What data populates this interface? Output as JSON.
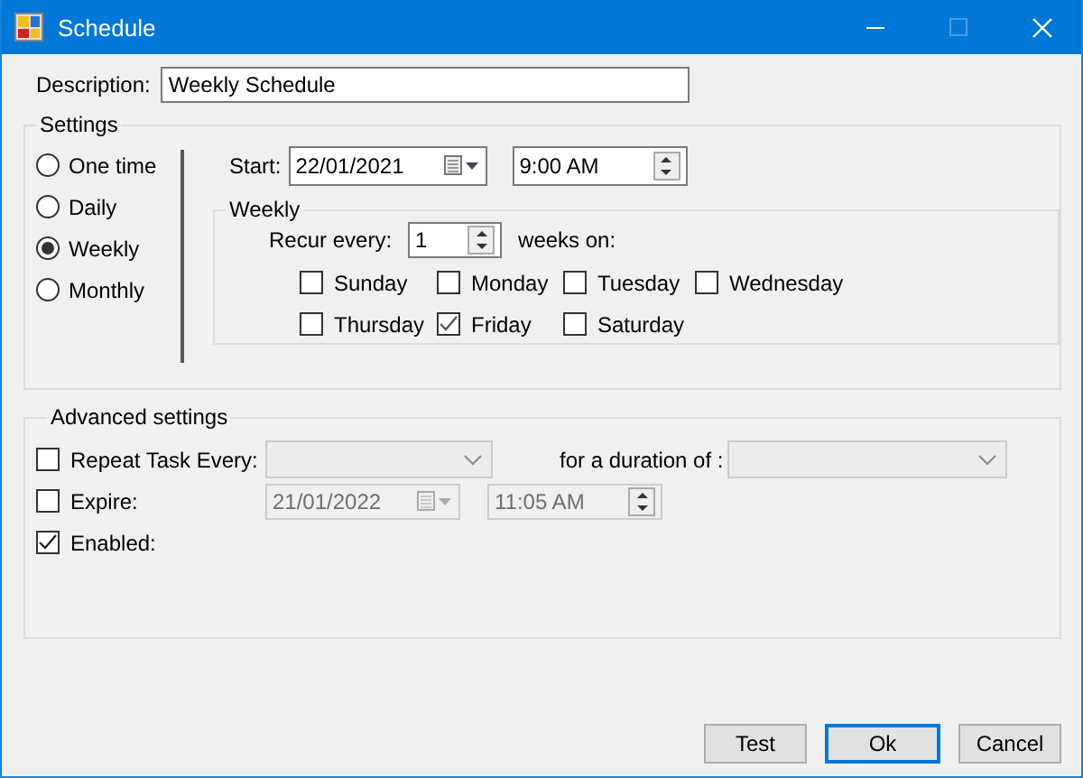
{
  "window": {
    "title": "Schedule"
  },
  "description": {
    "label": "Description:",
    "value": "Weekly Schedule"
  },
  "settings": {
    "title": "Settings",
    "frequency": [
      {
        "label": "One time",
        "selected": false
      },
      {
        "label": "Daily",
        "selected": false
      },
      {
        "label": "Weekly",
        "selected": true
      },
      {
        "label": "Monthly",
        "selected": false
      }
    ],
    "start": {
      "label": "Start:",
      "date": "22/01/2021",
      "time": "9:00 AM"
    },
    "weekly": {
      "title": "Weekly",
      "recur_label": "Recur every:",
      "recur_value": "1",
      "suffix": "weeks on:",
      "days": [
        {
          "label": "Sunday",
          "checked": false
        },
        {
          "label": "Monday",
          "checked": false
        },
        {
          "label": "Tuesday",
          "checked": false
        },
        {
          "label": "Wednesday",
          "checked": false
        },
        {
          "label": "Thursday",
          "checked": false
        },
        {
          "label": "Friday",
          "checked": true
        },
        {
          "label": "Saturday",
          "checked": false
        }
      ]
    }
  },
  "advanced": {
    "title": "Advanced settings",
    "repeat": {
      "label": "Repeat Task Every:",
      "checked": false
    },
    "duration_label": "for a duration of :",
    "expire": {
      "label": "Expire:",
      "checked": false,
      "date": "21/01/2022",
      "time": "11:05 AM"
    },
    "enabled": {
      "label": "Enabled:",
      "checked": true
    }
  },
  "buttons": [
    {
      "label": "Test",
      "default": false
    },
    {
      "label": "Ok",
      "default": true
    },
    {
      "label": "Cancel",
      "default": false
    }
  ]
}
